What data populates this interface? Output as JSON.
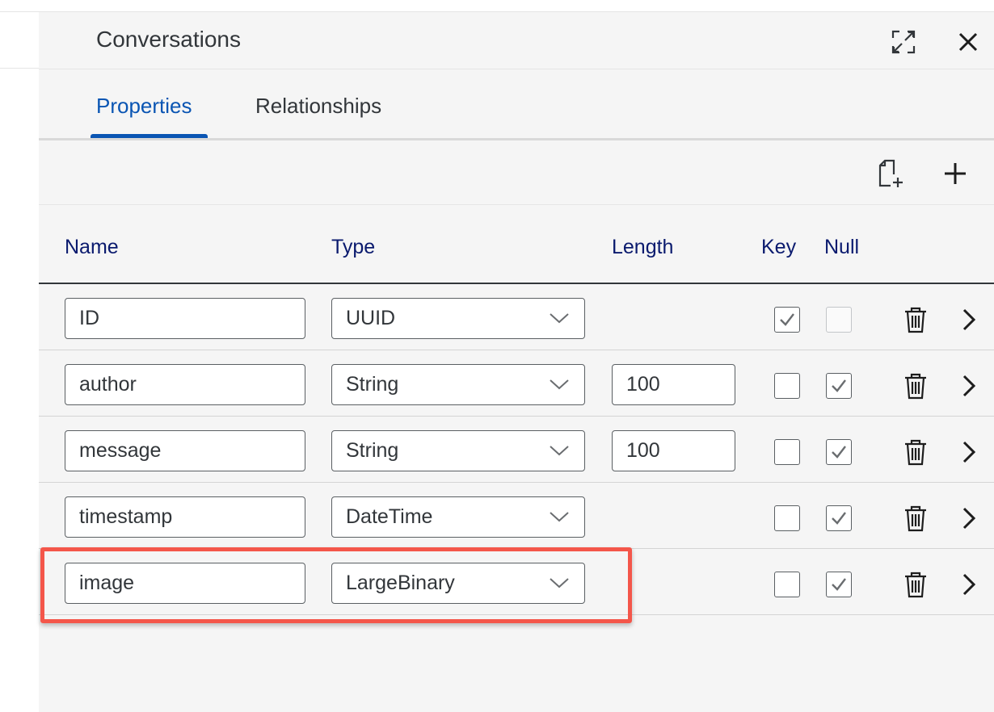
{
  "panel": {
    "title": "Conversations",
    "expand_icon": "expand-icon",
    "close_icon": "close-icon"
  },
  "tabs": [
    {
      "label": "Properties",
      "active": true
    },
    {
      "label": "Relationships",
      "active": false
    }
  ],
  "toolbar": {
    "add_file_icon": "add-file-icon",
    "add_icon": "plus-icon"
  },
  "columns": {
    "name": "Name",
    "type": "Type",
    "length": "Length",
    "key": "Key",
    "null": "Null"
  },
  "rows": [
    {
      "name": "ID",
      "type": "UUID",
      "length": "",
      "key": true,
      "null": false,
      "null_disabled": true
    },
    {
      "name": "author",
      "type": "String",
      "length": "100",
      "key": false,
      "null": true
    },
    {
      "name": "message",
      "type": "String",
      "length": "100",
      "key": false,
      "null": true
    },
    {
      "name": "timestamp",
      "type": "DateTime",
      "length": "",
      "key": false,
      "null": true
    },
    {
      "name": "image",
      "type": "LargeBinary",
      "length": "",
      "key": false,
      "null": true,
      "highlighted": true
    }
  ],
  "colors": {
    "accent": "#0a55b3",
    "header_text": "#0a1a6e",
    "highlight": "#f4564a"
  }
}
